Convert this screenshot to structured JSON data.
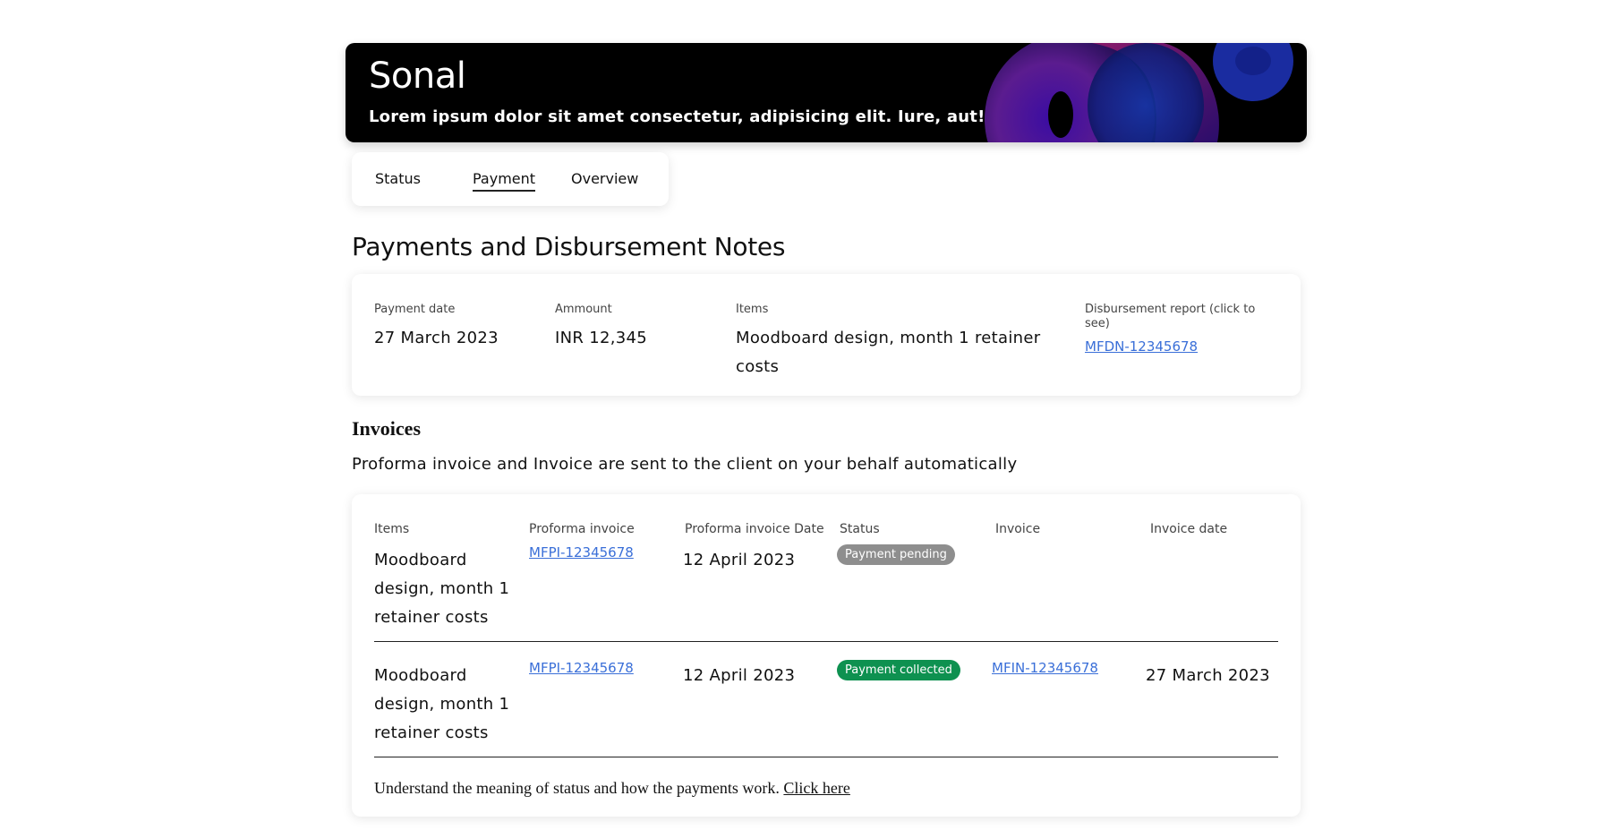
{
  "hero": {
    "title": "Sonal",
    "subtitle": "Lorem ipsum dolor sit amet consectetur, adipisicing elit. Iure, aut!"
  },
  "tabs": [
    {
      "label": "Status",
      "active": false
    },
    {
      "label": "Payment",
      "active": true
    },
    {
      "label": "Overview",
      "active": false
    }
  ],
  "payments": {
    "section_title": "Payments and Disbursement Notes",
    "payment_date_label": "Payment date",
    "payment_date": "27 March 2023",
    "amount_label": "Ammount",
    "amount": "INR 12,345",
    "items_label": "Items",
    "items": "Moodboard design, month 1 retainer costs",
    "report_label": "Disbursement report (click to see)",
    "report_link": "MFDN-12345678"
  },
  "invoices": {
    "title": "Invoices",
    "description": "Proforma invoice and Invoice are sent to the client on your behalf automatically",
    "headers": [
      "Items",
      "Proforma invoice",
      "Proforma invoice Date",
      "Status",
      "Invoice",
      "Invoice date"
    ],
    "rows": [
      {
        "item": "Moodboard design, month 1 retainer costs",
        "proforma": "MFPI-12345678",
        "proforma_date": "12 April 2023",
        "status": "Payment pending",
        "status_color": "#8e8e8e",
        "invoice": "",
        "invoice_date": ""
      },
      {
        "item": "Moodboard design, month 1 retainer costs",
        "proforma": "MFPI-12345678",
        "proforma_date": "12 April 2023",
        "status": "Payment collected",
        "status_color": "#0e9150",
        "invoice": "MFIN-12345678",
        "invoice_date": "27 March 2023"
      }
    ],
    "footnote": "Understand the meaning of status and how the payments work.",
    "footnote_link": "Click here"
  },
  "colors": {
    "link": "#3a6fd8",
    "pending": "#8e8e8e",
    "collected": "#0e9150"
  }
}
